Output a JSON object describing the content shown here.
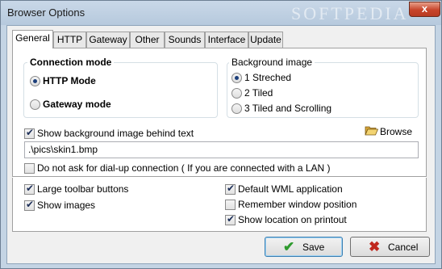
{
  "window": {
    "title": "Browser Options",
    "watermark": "SOFTPEDIA",
    "close_symbol": "x"
  },
  "tabs": [
    {
      "label": "General",
      "active": true
    },
    {
      "label": "HTTP"
    },
    {
      "label": "Gateway"
    },
    {
      "label": "Other"
    },
    {
      "label": "Sounds"
    },
    {
      "label": "Interface"
    },
    {
      "label": "Update"
    }
  ],
  "connection_mode": {
    "title": "Connection mode",
    "options": [
      {
        "label": "HTTP Mode",
        "selected": true
      },
      {
        "label": "Gateway mode",
        "selected": false
      }
    ]
  },
  "background_image": {
    "title": "Background image",
    "options": [
      {
        "label": "1 Streched",
        "selected": true
      },
      {
        "label": "2 Tiled",
        "selected": false
      },
      {
        "label": "3 Tiled and Scrolling",
        "selected": false
      }
    ]
  },
  "show_bg_text": {
    "label": "Show background image behind text",
    "checked": true
  },
  "browse": {
    "label": "Browse",
    "icon": "folder-open-icon"
  },
  "bg_path": {
    "value": ".\\pics\\skin1.bmp"
  },
  "dialup": {
    "label": "Do not ask for dial-up connection ( If you are connected with a LAN )",
    "checked": false
  },
  "options_left": [
    {
      "label": "Large toolbar buttons",
      "checked": true
    },
    {
      "label": "Show images",
      "checked": true
    }
  ],
  "options_right": [
    {
      "label": "Default WML application",
      "checked": true
    },
    {
      "label": "Remember window position",
      "checked": false
    },
    {
      "label": "Show location on printout",
      "checked": true
    }
  ],
  "buttons": {
    "save": {
      "label": "Save",
      "icon": "checkmark-icon",
      "color": "#2e9a2e"
    },
    "cancel": {
      "label": "Cancel",
      "icon": "x-icon",
      "color": "#c0281e"
    }
  }
}
